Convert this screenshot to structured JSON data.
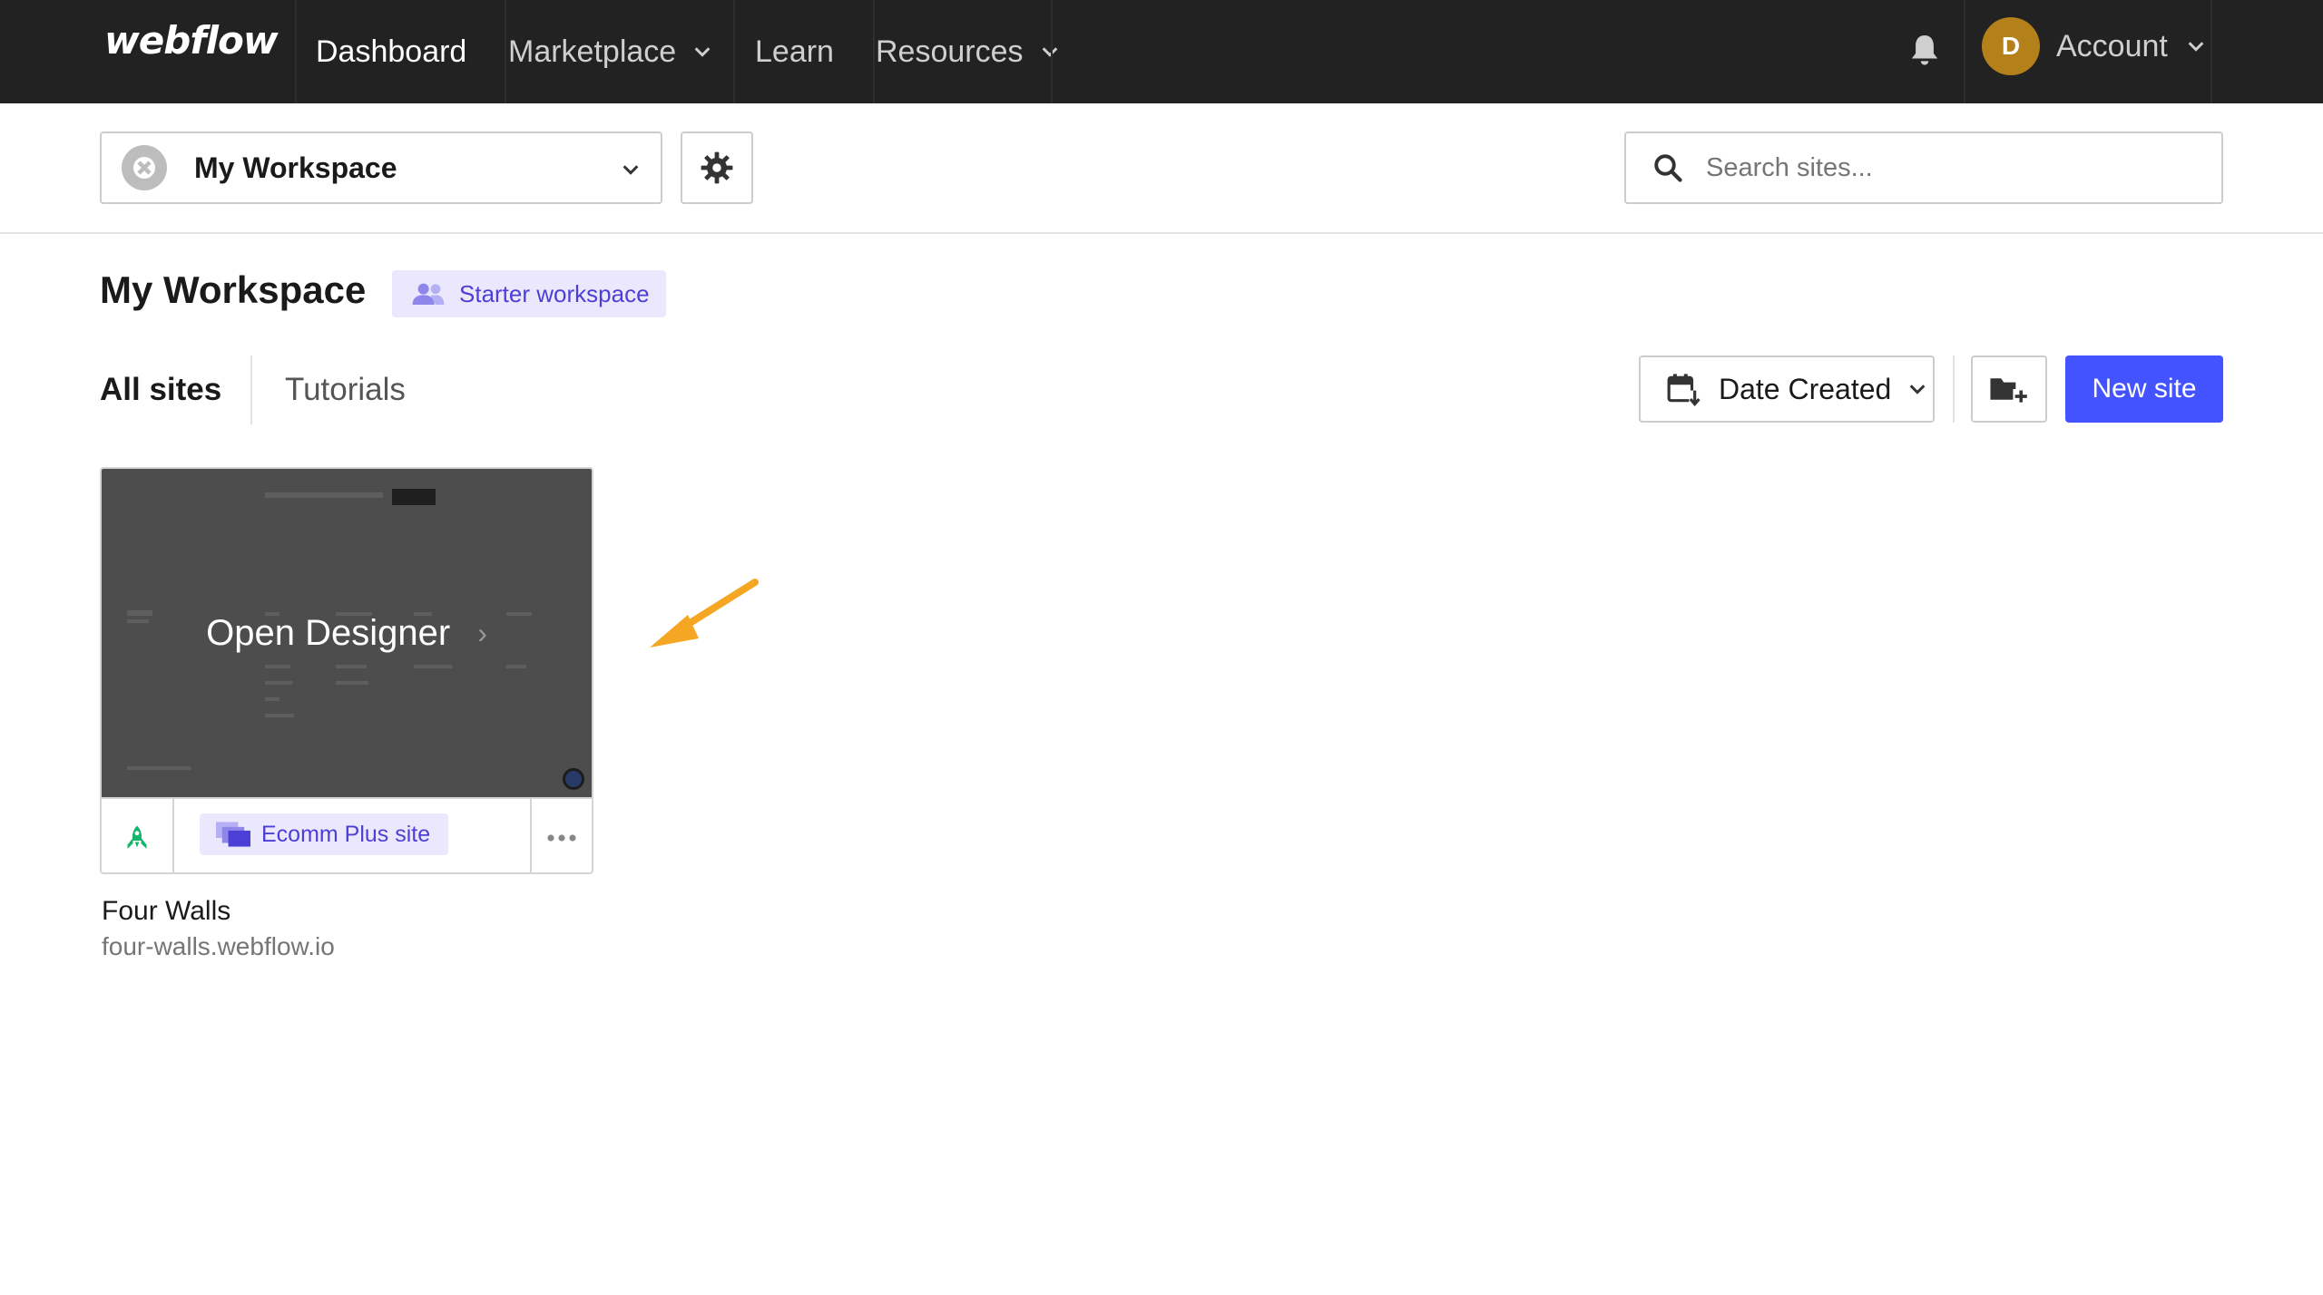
{
  "nav": {
    "logo": "webflow",
    "items": [
      {
        "label": "Dashboard"
      },
      {
        "label": "Marketplace"
      },
      {
        "label": "Learn"
      },
      {
        "label": "Resources"
      }
    ],
    "avatar_initial": "D",
    "account_label": "Account"
  },
  "subheader": {
    "workspace_label": "My Workspace",
    "search_placeholder": "Search sites..."
  },
  "workspace": {
    "title": "My Workspace",
    "plan_badge": "Starter workspace"
  },
  "tabs": [
    {
      "label": "All sites",
      "active": true
    },
    {
      "label": "Tutorials",
      "active": false
    }
  ],
  "controls": {
    "sort_label": "Date Created",
    "new_site_label": "New site"
  },
  "sites": [
    {
      "overlay_label": "Open Designer",
      "plan_label": "Ecomm Plus site",
      "name": "Four Walls",
      "url": "four-walls.webflow.io"
    }
  ],
  "colors": {
    "nav_bg": "#222222",
    "accent": "#4353ff",
    "badge_bg": "#ebe8fd",
    "badge_text": "#4c3fd6",
    "avatar": "#b3801a",
    "publish_green": "#12b76a",
    "annotation_arrow": "#f5a623"
  }
}
